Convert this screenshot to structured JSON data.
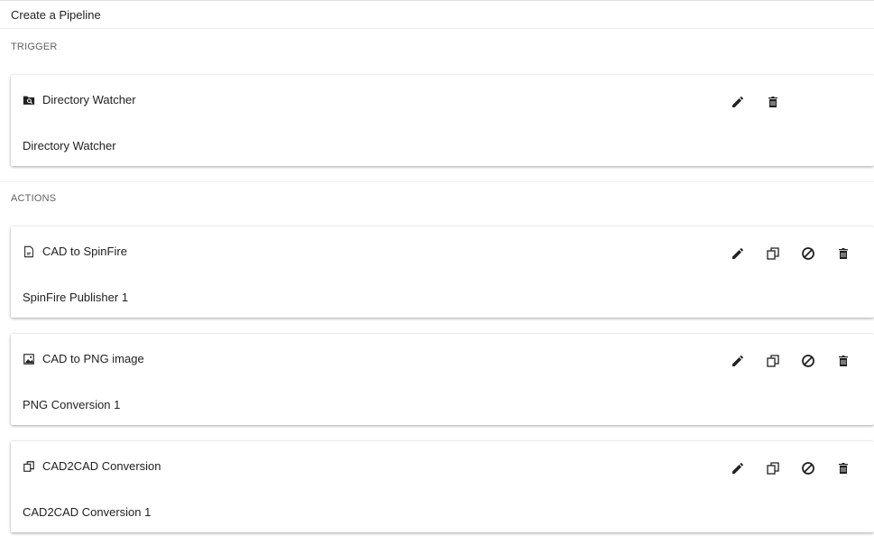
{
  "header": {
    "title": "Create a Pipeline"
  },
  "sections": {
    "trigger_label": "TRIGGER",
    "actions_label": "ACTIONS"
  },
  "trigger": {
    "title": "Directory Watcher",
    "subtitle": "Directory Watcher",
    "icon": "folder-search-icon"
  },
  "actions": [
    {
      "title": "CAD to SpinFire",
      "subtitle": "SpinFire Publisher 1",
      "icon": "file-document-icon"
    },
    {
      "title": "CAD to PNG image",
      "subtitle": "PNG Conversion 1",
      "icon": "image-file-icon"
    },
    {
      "title": "CAD2CAD Conversion",
      "subtitle": "CAD2CAD Conversion 1",
      "icon": "copy-convert-icon"
    }
  ],
  "colors": {
    "icon": "#212121",
    "label": "#616161",
    "divider": "#f0f0f0"
  }
}
